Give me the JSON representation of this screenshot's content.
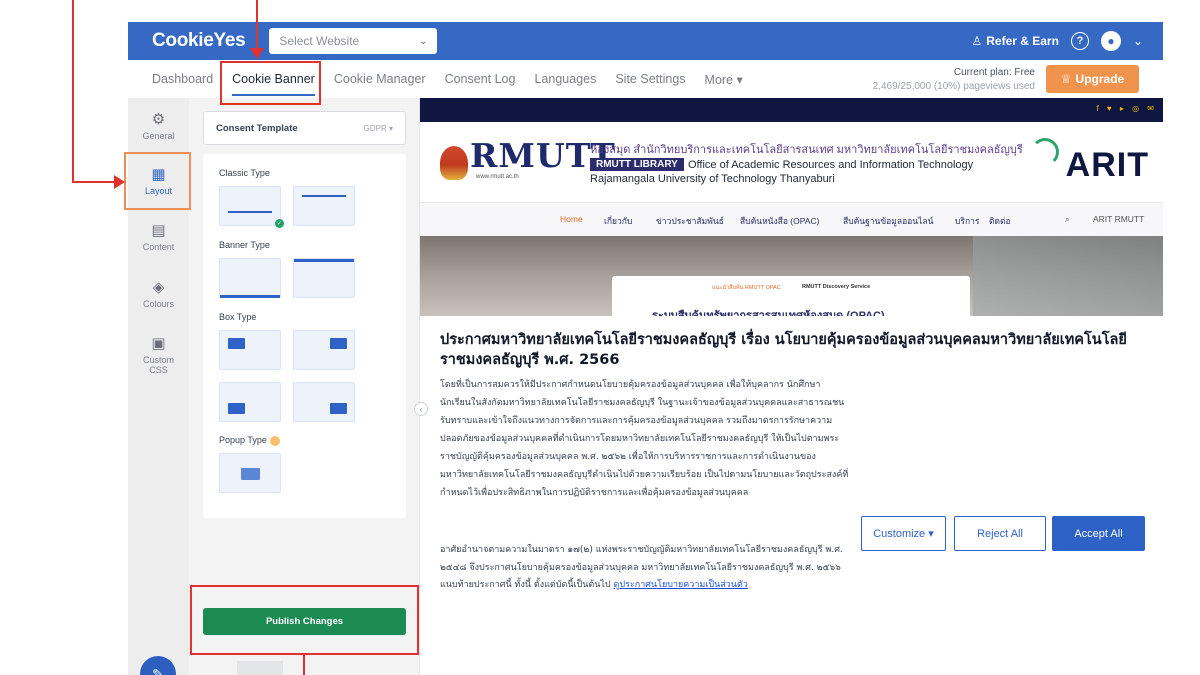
{
  "header": {
    "logo": "CookieYes",
    "site_select_placeholder": "Select Website",
    "refer_label": "Refer & Earn",
    "help_icon": "?",
    "user_icon": "user-icon",
    "brand_color": "#3569c4"
  },
  "nav": {
    "items": [
      {
        "label": "Dashboard"
      },
      {
        "label": "Cookie Banner"
      },
      {
        "label": "Cookie Manager"
      },
      {
        "label": "Consent Log"
      },
      {
        "label": "Languages"
      },
      {
        "label": "Site Settings"
      },
      {
        "label": "More ▾"
      }
    ],
    "active_index": 1,
    "plan_label": "Current plan: Free",
    "pageviews": "2,469/25,000 (10%) pageviews used",
    "upgrade_label": "Upgrade"
  },
  "rail": {
    "items": [
      {
        "label": "General",
        "icon": "gear-icon"
      },
      {
        "label": "Layout",
        "icon": "grid-icon"
      },
      {
        "label": "Content",
        "icon": "document-icon"
      },
      {
        "label": "Colours",
        "icon": "paint-icon"
      },
      {
        "label": "Custom",
        "label2": "CSS",
        "icon": "css-icon"
      }
    ],
    "active": "Layout"
  },
  "panel": {
    "template_label": "Consent Template",
    "template_value": "GDPR ▾",
    "sections": {
      "classic": "Classic Type",
      "banner": "Banner Type",
      "box": "Box Type",
      "popup": "Popup Type"
    },
    "publish_label": "Publish Changes"
  },
  "preview": {
    "library": {
      "logo_text": "RMUTT",
      "url": "www.rmutt.ac.th",
      "thai_title": "ห้องสมุด สำนักวิทยบริการและเทคโนโลยีสารสนเทศ มหาวิทยาลัยเทคโนโลยีราชมงคลธัญบุรี",
      "badge": "RMUTT LIBRARY",
      "en_line1": "Office of Academic Resources and Information Technology",
      "en_line2": "Rajamangala University of Technology Thanyaburi",
      "arit": "ARIT"
    },
    "menu": [
      "Home",
      "เกี่ยวกับ",
      "ข่าวประชาสัมพันธ์",
      "สืบค้นหนังสือ (OPAC)",
      "สืบค้นฐานข้อมูลออนไลน์",
      "บริการ",
      "ติดต่อ",
      "ARIT RMUTT"
    ],
    "hero": {
      "tab1": "แนะนำสืบค้น RMUTT OPAC",
      "tab2": "RMUTT Discovery Service",
      "clipped": "ระบบสืบค้นทรัพยากรสารสนเทศห้องสมุด (OPAC)"
    },
    "notice": {
      "title": "ประกาศมหาวิทยาลัยเทคโนโลยีราชมงคลธัญบุรี เรื่อง นโยบายคุ้มครองข้อมูลส่วนบุคคลมหาวิทยาลัยเทคโนโลยีราชมงคลธัญบุรี พ.ศ. 2566",
      "paragraph1": "โดยที่เป็นการสมควรให้มีประกาศกำหนดนโยบายคุ้มครองข้อมูลส่วนบุคคล เพื่อให้บุคลากร นักศึกษา นักเรียนในสังกัดมหาวิทยาลัยเทคโนโลยีราชมงคลธัญบุรี ในฐานะเจ้าของข้อมูลส่วนบุคคลและสาธารณชนรับทราบและเข้าใจถึงแนวทางการจัดการและการคุ้มครองข้อมูลส่วนบุคคล รวมถึงมาตรการรักษาความปลอดภัยของข้อมูลส่วนบุคคลที่ดำเนินการโดยมหาวิทยาลัยเทคโนโลยีราชมงคลธัญบุรี ให้เป็นไปตามพระราชบัญญัติคุ้มครองข้อมูลส่วนบุคคล พ.ศ. ๒๕๖๒ เพื่อให้การบริหารราชการและการดำเนินงานของมหาวิทยาลัยเทคโนโลยีราชมงคลธัญบุรีดำเนินไปด้วยความเรียบร้อย เป็นไปตามนโยบายและวัตถุประสงค์ที่กำหนดไว้เพื่อประสิทธิภาพในการปฏิบัติราชการและเพื่อคุ้มครองข้อมูลส่วนบุคคล",
      "paragraph2": "อาศัยอำนาจตามความในมาตรา ๑๗(๒) แห่งพระราชบัญญัติมหาวิทยาลัยเทคโนโลยีราชมงคลธัญบุรี พ.ศ. ๒๕๔๘ จึงประกาศนโยบายคุ้มครองข้อมูลส่วนบุคคล มหาวิทยาลัยเทคโนโลยีราชมงคลธัญบุรี พ.ศ. ๒๕๖๖ แนบท้ายประกาศนี้ ทั้งนี้ ตั้งแต่บัดนี้เป็นต้นไป",
      "link": "ดูประกาศนโยบายความเป็นส่วนตัว"
    },
    "buttons": {
      "customize": "Customize ▾",
      "reject": "Reject All",
      "accept": "Accept All"
    }
  },
  "annotation_color": "#e0322e"
}
